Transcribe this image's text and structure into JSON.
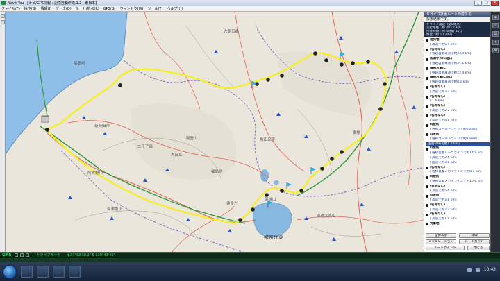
{
  "window": {
    "title": "Navit You - [ナビ/GPS情報 : 記憶自動作成.1.2 : 東日本]",
    "min_label": "_",
    "max_label": "□",
    "close_label": "×"
  },
  "menu": [
    "ファイル(F)",
    "操作(G)",
    "情報(I)",
    "データ(D)",
    "ルート/地点(R)",
    "GPS(G)",
    "ウィンドウ(W)",
    "ツール(T)",
    "ヘルプ(H)"
  ],
  "map": {
    "places": [
      {
        "label": "大朝日岳",
        "cls": "mid"
      },
      {
        "label": "福島県",
        "cls": "mid"
      },
      {
        "label": "二王子岳",
        "cls": "mid"
      },
      {
        "label": "飯豊山",
        "cls": "mid"
      },
      {
        "label": "大日岳",
        "cls": "mid"
      },
      {
        "label": "角田丘陵",
        "cls": "mid"
      },
      {
        "label": "福島県",
        "cls": "mid"
      },
      {
        "label": "安達太良山",
        "cls": "mid"
      },
      {
        "label": "猪苗代湖",
        "cls": "big"
      },
      {
        "label": "阿賀野川",
        "cls": "mid"
      },
      {
        "label": "新発田市",
        "cls": "mid"
      },
      {
        "label": "喜多方",
        "cls": "mid"
      },
      {
        "label": "磐梯山",
        "cls": "mid"
      },
      {
        "label": "東根",
        "cls": "mid"
      },
      {
        "label": "会津坂下",
        "cls": "mid"
      }
    ]
  },
  "panel": {
    "title": "ドライブ計画ルート作成する",
    "subtitle": "探索結果です。",
    "summary": [
      "ドライブ設定（全8地点）",
      "走行距離 : 約 482.1 km",
      "所要時間 : 約 8時間 35分",
      "料金 : 約 5,870円"
    ],
    "items": [
      {
        "kind": "point",
        "text": "出発地"
      },
      {
        "kind": "seg",
        "text": "[ 高速で約5.4 km]"
      },
      {
        "kind": "point",
        "text": "(名称なし)"
      },
      {
        "kind": "seg",
        "text": "[ 磐越自動車道で約23.9 km]"
      },
      {
        "kind": "point",
        "text": "新潟中央IC出口"
      },
      {
        "kind": "seg",
        "text": "[ 磐越自動車道で約57.1 km]"
      },
      {
        "kind": "point",
        "text": "磐梯河東IC"
      },
      {
        "kind": "seg",
        "text": "[ 磐越自動車道で約23.4 km]"
      },
      {
        "kind": "point",
        "text": "磐梯河東IC出口"
      },
      {
        "kind": "seg",
        "text": "[ 磐越自動車道で約8.1 km]"
      },
      {
        "kind": "point",
        "text": "(名称なし)"
      },
      {
        "kind": "seg",
        "text": "[ 高速で約3.1 km]"
      },
      {
        "kind": "point",
        "text": "(名称なし)"
      },
      {
        "kind": "seg",
        "text": "[ 1.6 km]"
      },
      {
        "kind": "point",
        "text": "(名称なし)"
      },
      {
        "kind": "seg",
        "text": "[ 高速で約2.2 km]"
      },
      {
        "kind": "point",
        "text": "(名称なし)"
      },
      {
        "kind": "seg",
        "text": "[ 高速で約4.8 km]"
      },
      {
        "kind": "point",
        "text": "料金所"
      },
      {
        "kind": "seg",
        "text": "[ 磐梯ゴールドラインで約6.2 km]"
      },
      {
        "kind": "point",
        "text": "料金所"
      },
      {
        "kind": "seg",
        "text": "[ 磐梯ゴールドラインで約3.9 km]"
      },
      {
        "kind": "sel",
        "text": "[ 国道49号で約4.2 km]"
      },
      {
        "kind": "point",
        "text": "料金所"
      },
      {
        "kind": "seg",
        "text": "[ 磐梯吾妻レークラインで約14.9 km]"
      },
      {
        "kind": "seg",
        "text": "[ 高速で約2.6 km]"
      },
      {
        "kind": "seg",
        "text": "[ 国道で約3.8 km]"
      },
      {
        "kind": "point",
        "text": "(名称なし)"
      },
      {
        "kind": "seg",
        "text": "[ 磐梯吾妻スカイラインで約8.1 km]"
      },
      {
        "kind": "point",
        "text": "料金所"
      },
      {
        "kind": "seg",
        "text": "[ 磐梯吾妻スカイラインで約10.6 km]"
      },
      {
        "kind": "point",
        "text": "(名称なし)"
      },
      {
        "kind": "seg",
        "text": "[ 高速で約5.6 km]"
      },
      {
        "kind": "point",
        "text": "料金所"
      },
      {
        "kind": "seg",
        "text": "[ 高速で約3.8 km]"
      },
      {
        "kind": "point",
        "text": "(名称なし)"
      },
      {
        "kind": "seg",
        "text": "[ 高速で約2.1 km]"
      },
      {
        "kind": "point",
        "text": "(名称なし)"
      },
      {
        "kind": "seg",
        "text": "[ 高速で約1.9 km]"
      },
      {
        "kind": "point",
        "text": "到着地"
      }
    ],
    "buttons": {
      "all_route": "全体表示",
      "details": "詳細",
      "simulation": "シミュレーション",
      "route_guide": "ルートガイド",
      "route_point": "ルートポイント",
      "close": "閉じる"
    }
  },
  "gps": {
    "label": "GPS",
    "status": "ドライブモード",
    "coords": "N 37°33'38.2\"  E 139°43'40\""
  },
  "taskbar": {
    "clock": "10:42"
  },
  "colors": {
    "route": "#f5ee2a",
    "highway": "#2f9a3e",
    "road_major": "#e05a4a",
    "boundary": "#6a5acd",
    "water": "#86b8e0"
  }
}
